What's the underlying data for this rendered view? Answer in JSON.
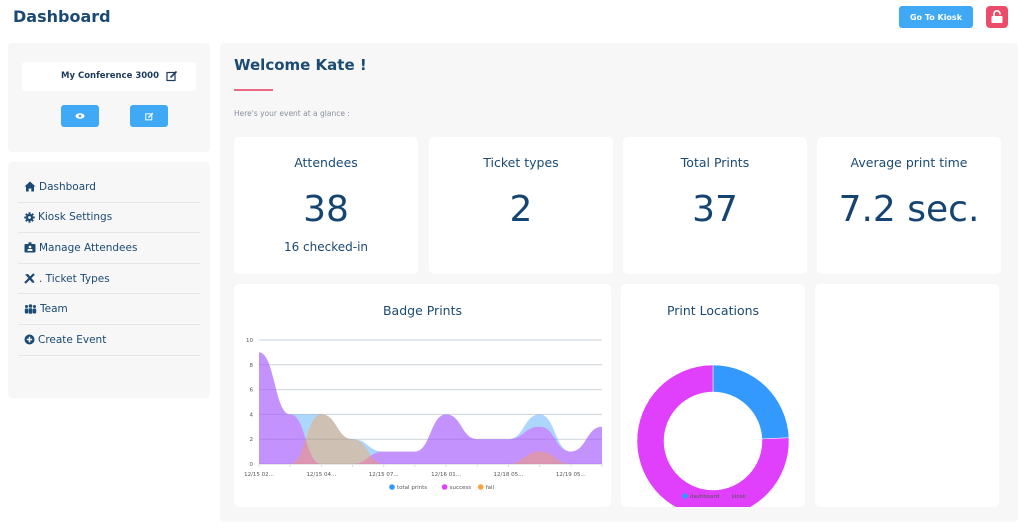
{
  "header": {
    "title": "Dashboard",
    "go_to_kiosk_label": "Go To Kiosk",
    "lock_icon": "unlock-icon",
    "accent": "#3fa9f5",
    "lock_color": "#ea4c6a"
  },
  "sidebar": {
    "event_name": "My Conference 3000",
    "event_buttons": [
      {
        "icon": "eye-icon"
      },
      {
        "icon": "edit-icon"
      }
    ],
    "nav": [
      {
        "label": "Dashboard",
        "icon": "home-icon"
      },
      {
        "label": "Kiosk Settings",
        "icon": "gear-icon"
      },
      {
        "label": "Manage Attendees",
        "icon": "id-badge-icon"
      },
      {
        "label": ". Ticket Types",
        "icon": "tools-icon"
      },
      {
        "label": "Team",
        "icon": "users-icon"
      },
      {
        "label": "Create Event",
        "icon": "plus-circle-icon"
      }
    ]
  },
  "main": {
    "welcome": "Welcome Kate !",
    "subtitle": "Here's your event at a glance :",
    "stats": [
      {
        "label": "Attendees",
        "value": "38",
        "sub": "16 checked-in"
      },
      {
        "label": "Ticket types",
        "value": "2",
        "sub": ""
      },
      {
        "label": "Total Prints",
        "value": "37",
        "sub": ""
      },
      {
        "label": "Average print time",
        "value": "7.2 sec.",
        "sub": ""
      }
    ],
    "badge_prints_title": "Badge Prints",
    "print_locations_title": "Print Locations"
  },
  "chart_data": [
    {
      "type": "area",
      "title": "Badge Prints",
      "xlabel": "",
      "ylabel": "",
      "ylim": [
        0,
        10
      ],
      "yticks": [
        0,
        2,
        4,
        6,
        8,
        10
      ],
      "grid": true,
      "legend": "bottom",
      "x_tick_labels": [
        "12/15 02...",
        "12/15 04...",
        "12/15 07...",
        "12/16 01...",
        "12/18 05...",
        "12/19 05..."
      ],
      "x_count": 12,
      "series": [
        {
          "name": "total prints",
          "color": "#3399ff",
          "values": [
            9,
            4,
            4,
            2,
            1,
            1,
            4,
            2,
            2,
            4,
            1,
            3
          ]
        },
        {
          "name": "success",
          "color": "#e040fb",
          "values": [
            9,
            4,
            0,
            0,
            1,
            1,
            4,
            2,
            2,
            3,
            1,
            3
          ]
        },
        {
          "name": "fail",
          "color": "#ff9f40",
          "values": [
            0,
            0,
            4,
            2,
            0,
            0,
            0,
            0,
            0,
            1,
            0,
            0
          ]
        }
      ]
    },
    {
      "type": "pie",
      "title": "Print Locations",
      "donut": true,
      "legend": "bottom",
      "slices": [
        {
          "name": "dashboard",
          "value": 9,
          "color": "#3399ff"
        },
        {
          "name": "kiosk",
          "value": 28,
          "color": "#e040fb"
        }
      ]
    }
  ]
}
